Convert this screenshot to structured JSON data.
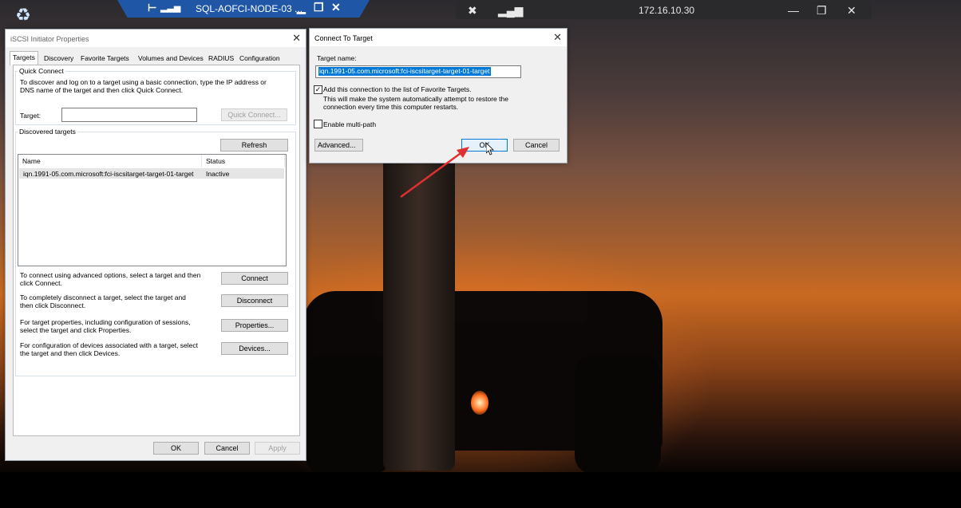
{
  "desktop": {
    "recycle_bin_icon": "recycle-bin-icon"
  },
  "rdp_bar": {
    "pin_icon": "pin-icon",
    "signal_icon": "signal-icon",
    "title": "SQL-AOFCI-NODE-03 ...",
    "minimize": "▁",
    "restore": "❐",
    "close": "✕"
  },
  "remote_bar": {
    "ip": "172.16.10.30",
    "minimize": "—",
    "restore": "❐",
    "close": "✕"
  },
  "iscsi_window": {
    "title": "iSCSI Initiator Properties",
    "tabs": [
      {
        "label": "Targets"
      },
      {
        "label": "Discovery"
      },
      {
        "label": "Favorite Targets"
      },
      {
        "label": "Volumes and Devices"
      },
      {
        "label": "RADIUS"
      },
      {
        "label": "Configuration"
      }
    ],
    "quick_connect": {
      "group_label": "Quick Connect",
      "description": "To discover and log on to a target using a basic connection, type the IP address or DNS name of the target and then click Quick Connect.",
      "target_label": "Target:",
      "target_value": "",
      "button": "Quick Connect..."
    },
    "discovered": {
      "group_label": "Discovered targets",
      "refresh": "Refresh",
      "columns": [
        "Name",
        "Status"
      ],
      "rows": [
        {
          "name": "iqn.1991-05.com.microsoft:fci-iscsitarget-target-01-target",
          "status": "Inactive"
        }
      ]
    },
    "actions": [
      {
        "text": "To connect using advanced options, select a target and then click Connect.",
        "button": "Connect"
      },
      {
        "text": "To completely disconnect a target, select the target and then click Disconnect.",
        "button": "Disconnect"
      },
      {
        "text": "For target properties, including configuration of sessions, select the target and click Properties.",
        "button": "Properties..."
      },
      {
        "text": "For configuration of devices associated with a target, select the target and then click Devices.",
        "button": "Devices..."
      }
    ],
    "footer": {
      "ok": "OK",
      "cancel": "Cancel",
      "apply": "Apply"
    }
  },
  "connect_dialog": {
    "title": "Connect To Target",
    "target_name_label": "Target name:",
    "target_name_value": "iqn.1991-05.com.microsoft:fci-iscsitarget-target-01-target",
    "favorites_checked": true,
    "favorites_label": "Add this connection to the list of Favorite Targets.",
    "favorites_note": "This will make the system automatically attempt to restore the connection every time this computer restarts.",
    "multipath_checked": false,
    "multipath_label": "Enable multi-path",
    "advanced": "Advanced...",
    "ok": "OK",
    "cancel": "Cancel"
  },
  "colors": {
    "accent": "#0078d7",
    "annotation_arrow": "#e03030",
    "rdp_bar": "#1f57a6"
  }
}
